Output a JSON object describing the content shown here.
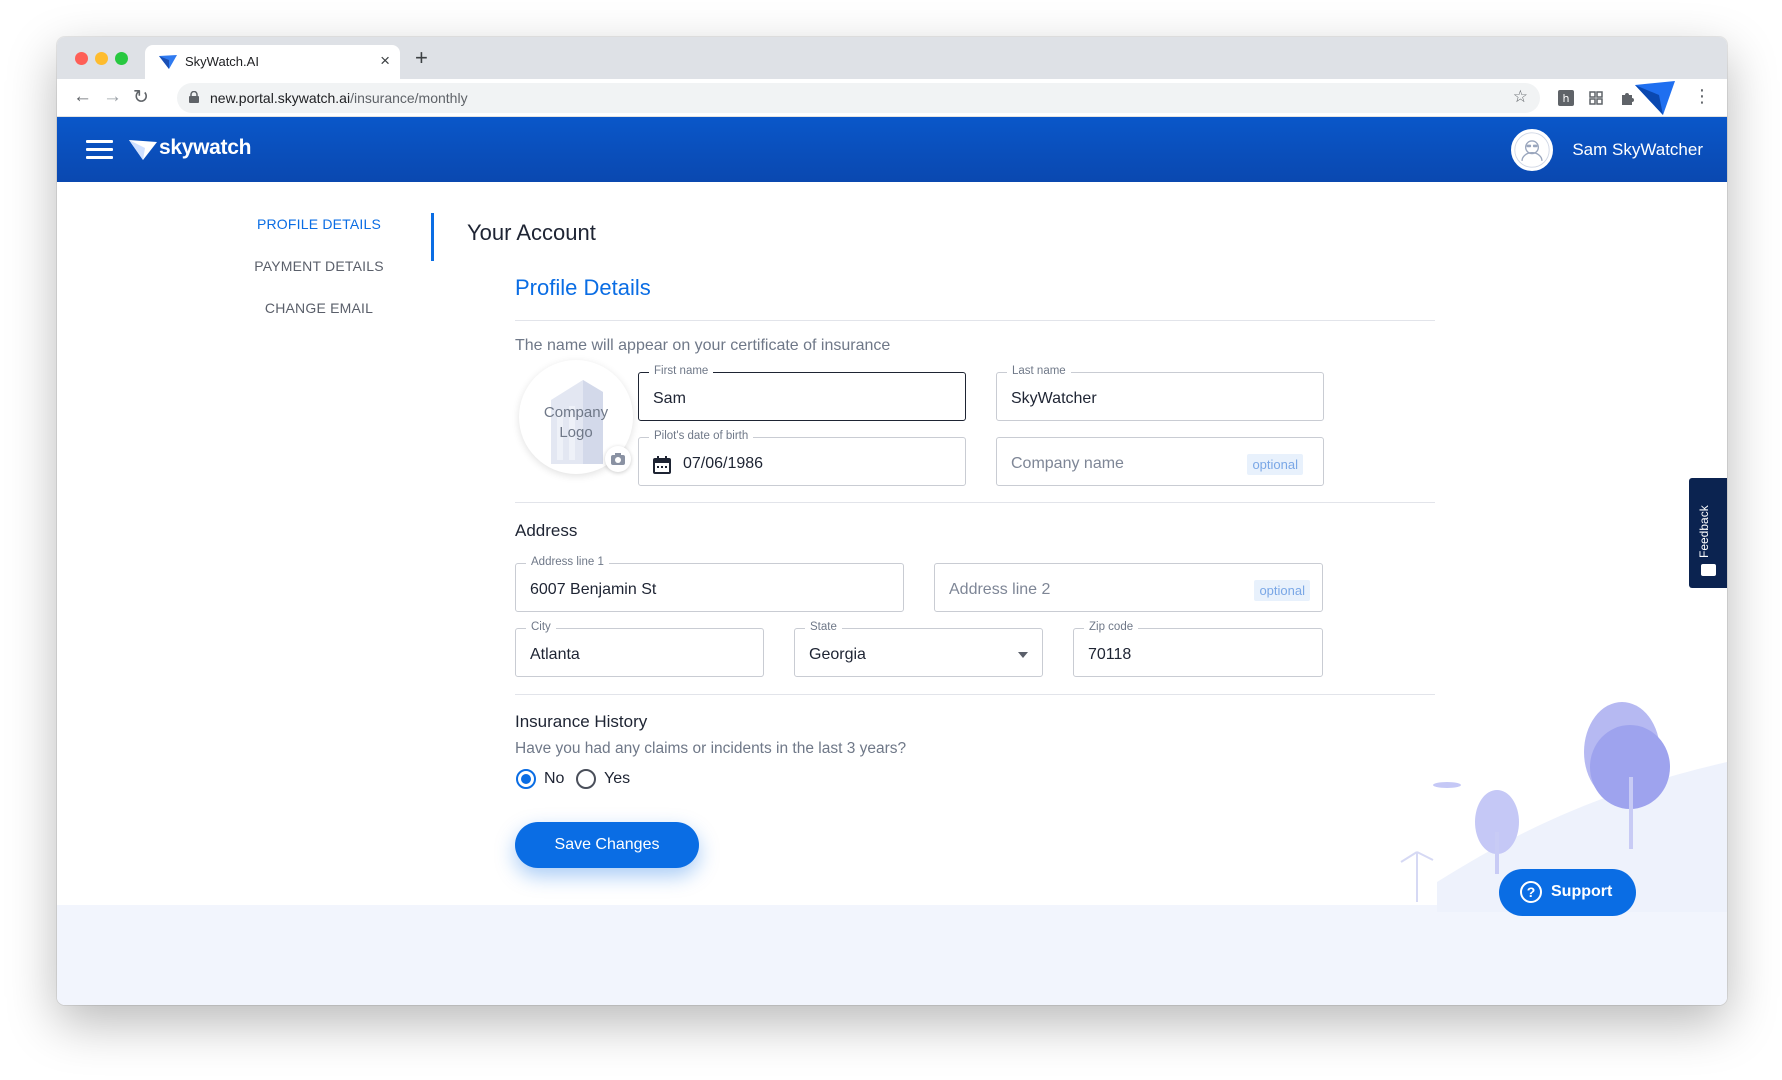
{
  "browser": {
    "tab_title": "SkyWatch.AI",
    "tab_close": "×",
    "new_tab": "+",
    "url_host": "new.portal.skywatch.ai",
    "url_path": "/insurance/monthly",
    "back": "←",
    "forward": "→",
    "reload": "↻",
    "bookmark_star": "☆"
  },
  "appbar": {
    "brand": "skywatch",
    "user_name": "Sam SkyWatcher"
  },
  "sidenav": {
    "items": [
      {
        "label": "PROFILE DETAILS",
        "active": true
      },
      {
        "label": "PAYMENT DETAILS",
        "active": false
      },
      {
        "label": "CHANGE EMAIL",
        "active": false
      }
    ]
  },
  "page": {
    "title": "Your Account",
    "section_title": "Profile Details",
    "helper": "The name will appear on your certificate of insurance",
    "logo_placeholder_line1": "Company",
    "logo_placeholder_line2": "Logo"
  },
  "profile": {
    "first_name_label": "First name",
    "first_name": "Sam",
    "last_name_label": "Last name",
    "last_name": "SkyWatcher",
    "dob_label": "Pilot's date of birth",
    "dob": "07/06/1986",
    "company_placeholder": "Company name",
    "optional": "optional"
  },
  "address": {
    "heading": "Address",
    "line1_label": "Address line 1",
    "line1": "6007 Benjamin St",
    "line2_placeholder": "Address line 2",
    "city_label": "City",
    "city": "Atlanta",
    "state_label": "State",
    "state": "Georgia",
    "zip_label": "Zip code",
    "zip": "70118"
  },
  "insurance": {
    "heading": "Insurance History",
    "question": "Have you had any claims or incidents in the last 3 years?",
    "options": [
      {
        "label": "No",
        "selected": true
      },
      {
        "label": "Yes",
        "selected": false
      }
    ]
  },
  "actions": {
    "save": "Save Changes",
    "support": "Support",
    "support_icon": "?",
    "feedback": "Feedback"
  },
  "colors": {
    "brand_blue": "#0a6de4",
    "header_blue": "#0a57c9",
    "feedback_navy": "#0b2350"
  }
}
